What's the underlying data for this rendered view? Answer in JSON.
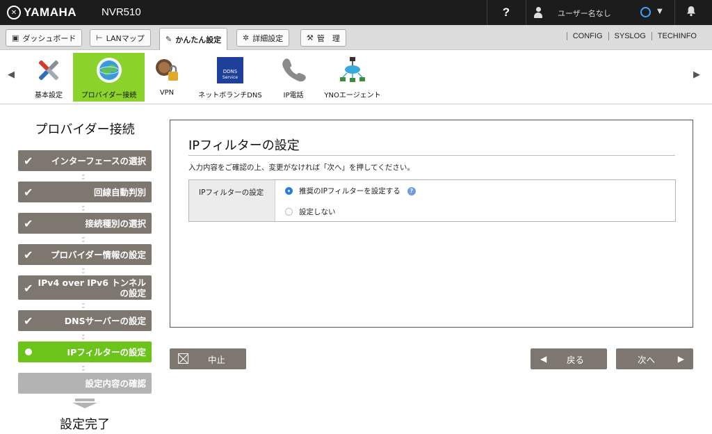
{
  "header": {
    "brand": "YAMAHA",
    "model": "NVR510",
    "help": "?",
    "user_name": "ユーザー名なし"
  },
  "tabs": [
    {
      "label": "ダッシュボード",
      "icon": "dashboard-icon"
    },
    {
      "label": "LANマップ",
      "icon": "lan-map-icon"
    },
    {
      "label": "かんたん設定",
      "icon": "easy-setup-icon",
      "active": true
    },
    {
      "label": "詳細設定",
      "icon": "gear-icon"
    },
    {
      "label": "管　理",
      "icon": "wrench-icon"
    }
  ],
  "top_links": [
    "CONFIG",
    "SYSLOG",
    "TECHINFO"
  ],
  "icon_strip": [
    {
      "label": "基本設定",
      "icon": "tools-icon"
    },
    {
      "label": "プロバイダー接続",
      "icon": "globe-icon",
      "selected": true
    },
    {
      "label": "VPN",
      "icon": "vpn-lock-icon"
    },
    {
      "label": "ネットボランチDNS",
      "icon": "dns-service-icon",
      "badge_text": "DDNS Service"
    },
    {
      "label": "IP電話",
      "icon": "phone-icon"
    },
    {
      "label": "YNOエージェント",
      "icon": "yno-agent-icon"
    }
  ],
  "wizard": {
    "title": "プロバイダー接続",
    "steps": [
      {
        "label": "インターフェースの選択",
        "state": "done"
      },
      {
        "label": "回線自動判別",
        "state": "done"
      },
      {
        "label": "接続種別の選択",
        "state": "done"
      },
      {
        "label": "プロバイダー情報の設定",
        "state": "done"
      },
      {
        "label": "IPv4 over IPv6 トンネル",
        "label2": "の設定",
        "state": "done"
      },
      {
        "label": "DNSサーバーの設定",
        "state": "done"
      },
      {
        "label": "IPフィルターの設定",
        "state": "current"
      },
      {
        "label": "設定内容の確認",
        "state": "pending"
      }
    ],
    "done_label": "設定完了"
  },
  "panel": {
    "title": "IPフィルターの設定",
    "description": "入力内容をご確認の上、変更がなければ「次へ」を押してください。",
    "field_label": "IPフィルターの設定",
    "options": [
      {
        "label": "推奨のIPフィルターを設定する",
        "selected": true
      },
      {
        "label": "設定しない",
        "selected": false
      }
    ],
    "help_mark": "?"
  },
  "buttons": {
    "cancel": "中止",
    "back": "戻る",
    "next": "次へ",
    "back_arrow": "◀",
    "next_arrow": "▶"
  },
  "colors": {
    "accent_green": "#6cc31a",
    "step_gray": "#7e7770",
    "radio_blue": "#2a7de1"
  }
}
